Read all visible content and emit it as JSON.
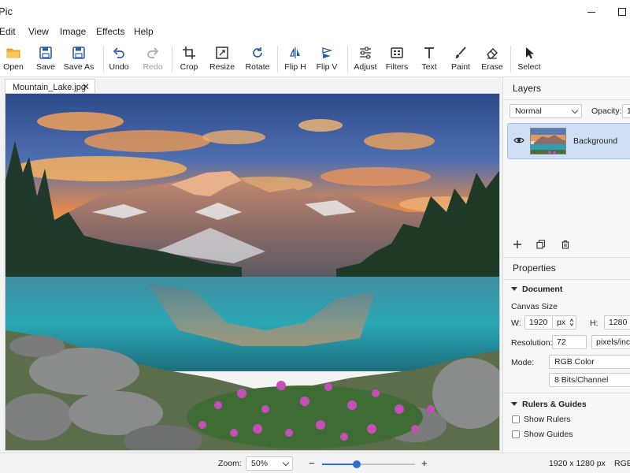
{
  "window": {
    "title": "Pic"
  },
  "menu": {
    "items": [
      "Edit",
      "View",
      "Image",
      "Effects",
      "Help"
    ]
  },
  "toolbar": {
    "open": "Open",
    "save": "Save",
    "save_as": "Save As",
    "undo": "Undo",
    "redo": "Redo",
    "crop": "Crop",
    "resize": "Resize",
    "rotate": "Rotate",
    "flip_h": "Flip H",
    "flip_v": "Flip V",
    "adjust": "Adjust",
    "filters": "Filters",
    "text": "Text",
    "paint": "Paint",
    "erase": "Erase",
    "select": "Select"
  },
  "document": {
    "tab_name": "Mountain_Lake.jpg",
    "close_glyph": "✕"
  },
  "layers": {
    "heading": "Layers",
    "blend_mode": "Normal",
    "opacity_label": "Opacity:",
    "opacity_value": "1",
    "layer_name": "Background"
  },
  "properties": {
    "heading": "Properties",
    "document_section": "Document",
    "canvas_size_label": "Canvas Size",
    "w_label": "W:",
    "w_value": "1920",
    "w_unit": "px",
    "h_label": "H:",
    "h_value": "1280",
    "resolution_label": "Resolution:",
    "resolution_value": "72",
    "resolution_unit": "pixels/inch",
    "mode_label": "Mode:",
    "mode_value": "RGB Color",
    "bits_value": "8 Bits/Channel",
    "rulers_section": "Rulers & Guides",
    "show_rulers": "Show Rulers",
    "show_guides": "Show Guides"
  },
  "status": {
    "zoom_label": "Zoom:",
    "zoom_value": "50%",
    "zoom_minus": "−",
    "zoom_plus": "+",
    "zoom_slider_fraction": 0.37,
    "dimensions": "1920 x 1280 px",
    "color_mode": "RGB,"
  },
  "colors": {
    "accent": "#2f6fd0",
    "layer_selected": "#cfe0f4",
    "icon_blue": "#2f5aa8"
  }
}
